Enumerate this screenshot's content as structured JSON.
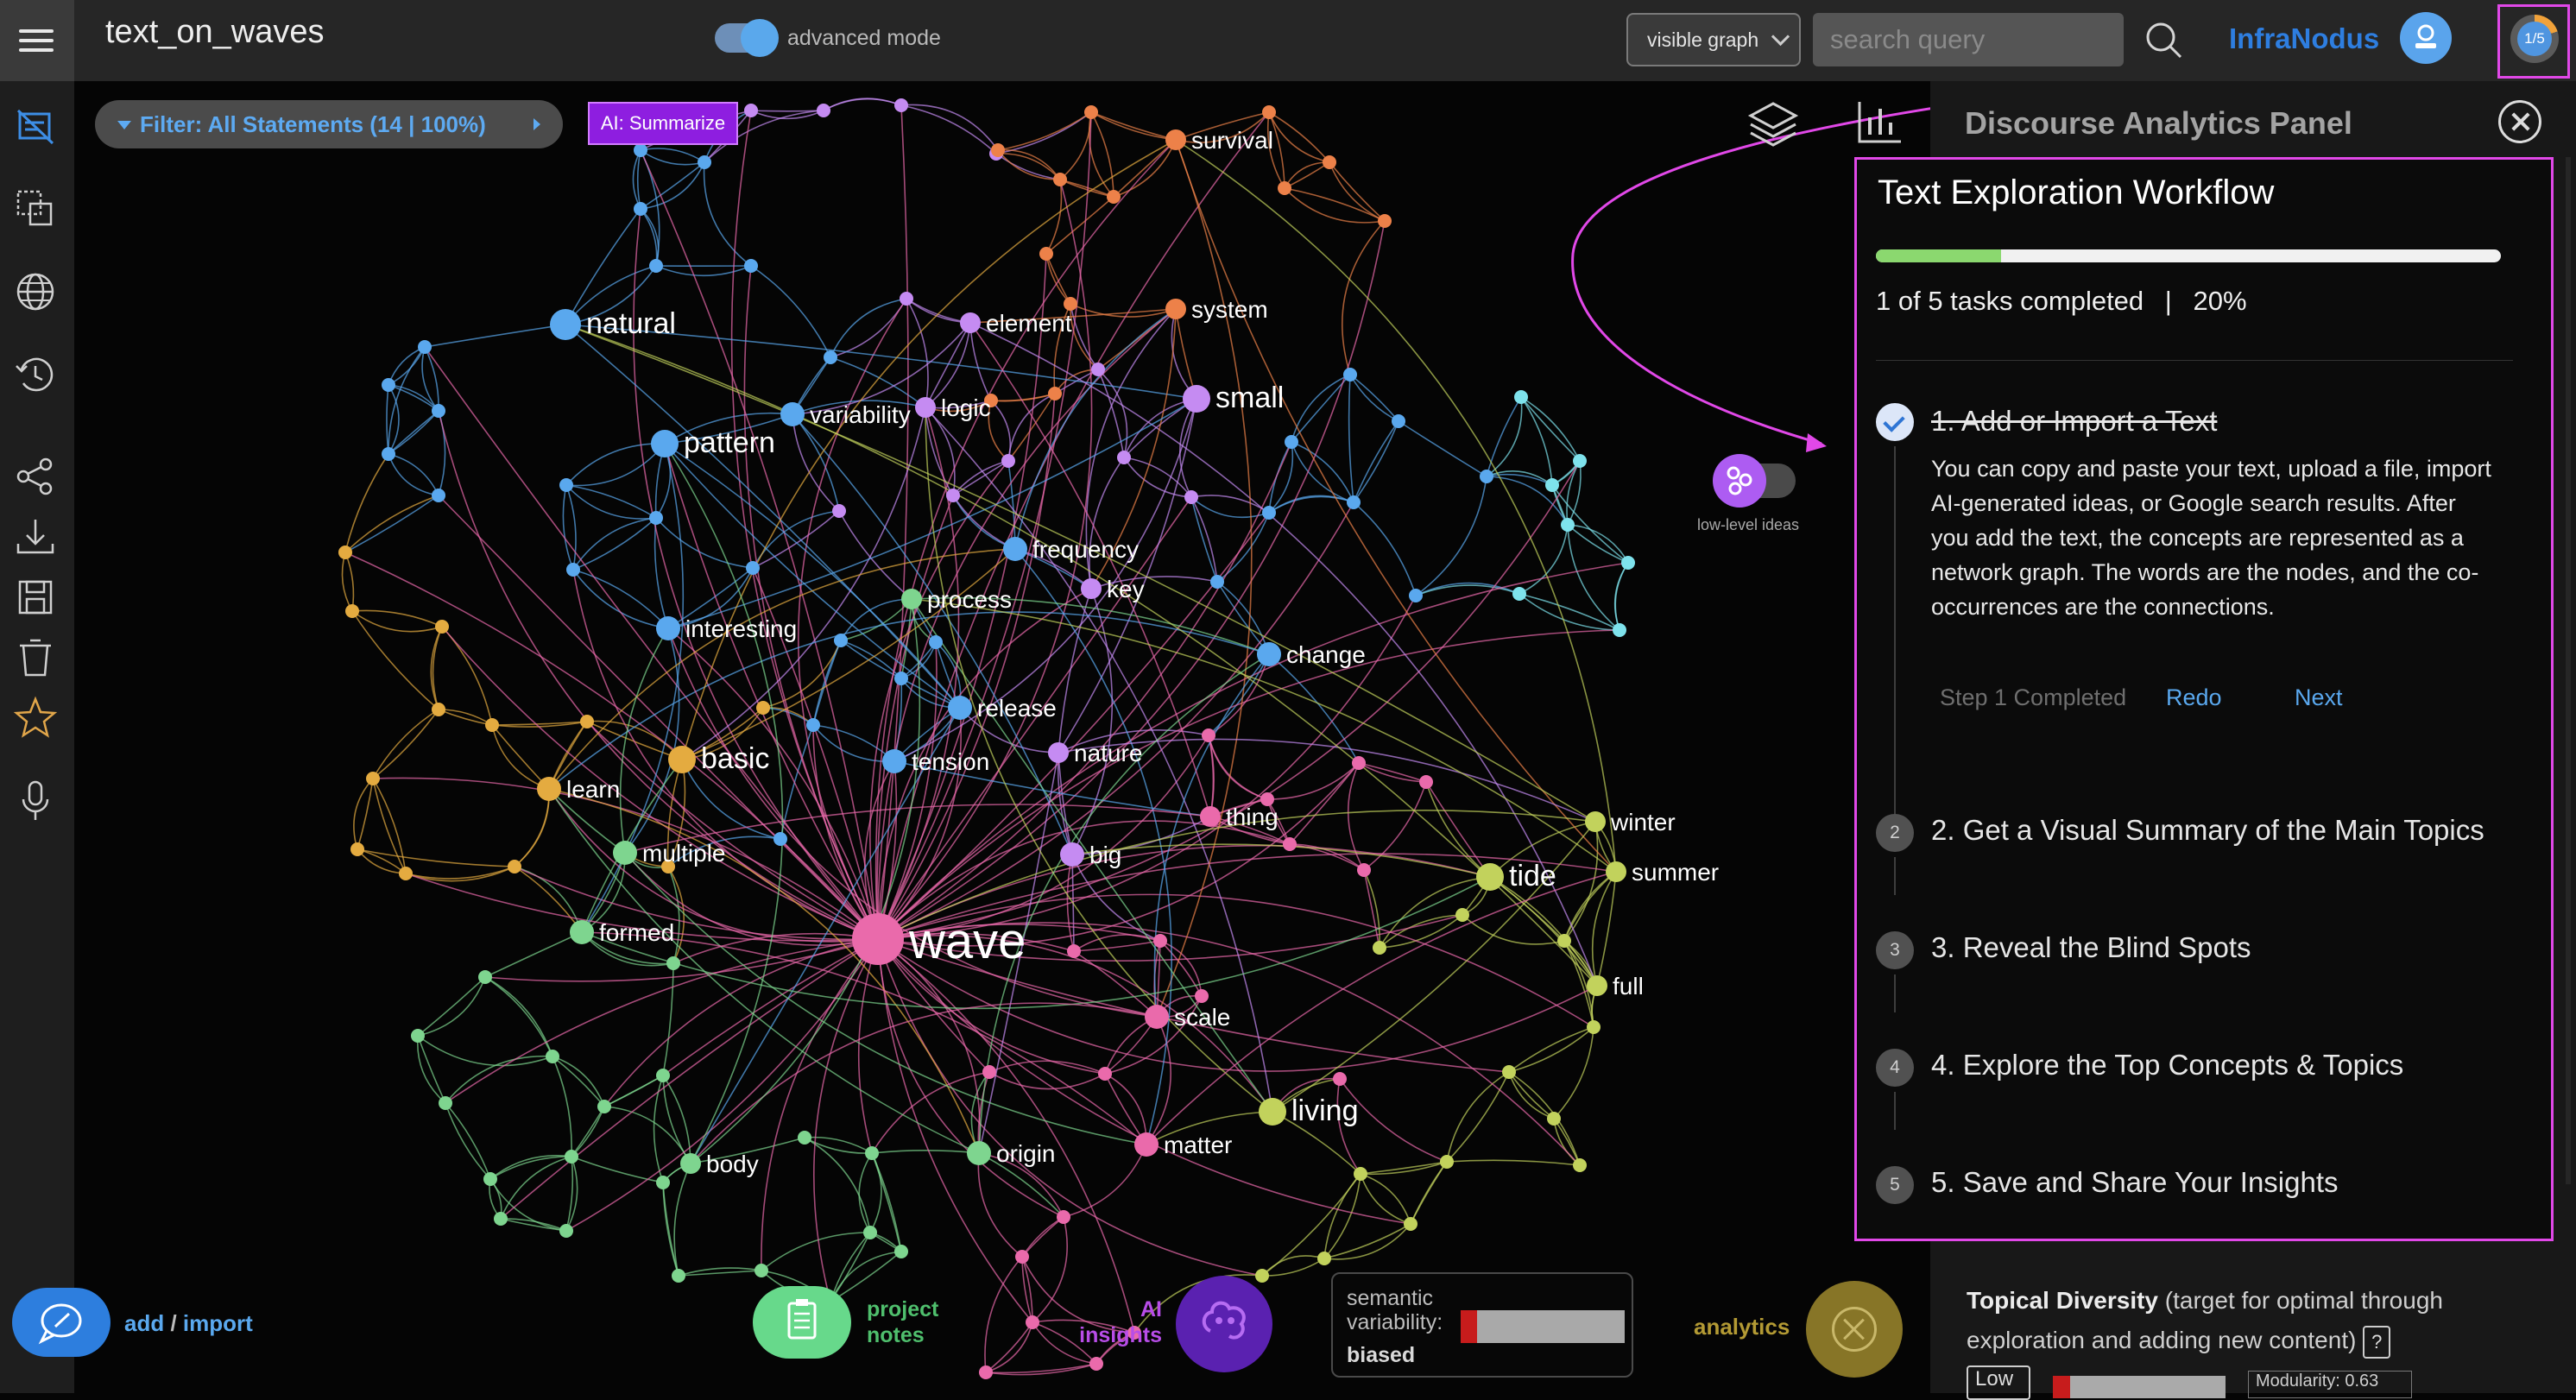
{
  "header": {
    "doc_title": "text_on_waves",
    "advanced_mode_label": "advanced mode",
    "advanced_mode_on": true,
    "graph_select_value": "visible graph",
    "search_placeholder": "search query",
    "brand": "InfraNodus",
    "progress_badge": "1/5",
    "progress_fraction": 0.2
  },
  "sidebar": {
    "icons": [
      "graph-filter-icon",
      "select-icon",
      "globe-icon",
      "history-icon",
      "share-icon",
      "download-icon",
      "save-icon",
      "trash-icon",
      "star-icon",
      "microphone-icon"
    ]
  },
  "graph": {
    "filter_label": "Filter: All Statements (14 | 100%)",
    "ai_summarize_label": "AI: Summarize",
    "low_level_label": "low-level ideas",
    "colors": {
      "blue": "#5aa8ee",
      "purple": "#c58bf2",
      "orange": "#ed8149",
      "yellow": "#e4ab40",
      "green": "#7ed58f",
      "pink": "#ea6aab",
      "lime": "#c2d25c",
      "cyan": "#7ee2ec"
    },
    "labels": {
      "wave": "wave",
      "natural": "natural",
      "pattern": "pattern",
      "variability": "variability",
      "logic": "logic",
      "element": "element",
      "system": "system",
      "small": "small",
      "survival": "survival",
      "frequency": "frequency",
      "key": "key",
      "process": "process",
      "interesting": "interesting",
      "change": "change",
      "release": "release",
      "basic": "basic",
      "tension": "tension",
      "nature": "nature",
      "learn": "learn",
      "thing": "thing",
      "multiple": "multiple",
      "big": "big",
      "tide": "tide",
      "winter": "winter",
      "summer": "summer",
      "formed": "formed",
      "full": "full",
      "scale": "scale",
      "living": "living",
      "body": "body",
      "origin": "origin",
      "matter": "matter"
    }
  },
  "panel": {
    "title": "Discourse Analytics Panel",
    "workflow_title": "Text Exploration Workflow",
    "tasks_completed_text": "1 of 5 tasks completed",
    "percent_text": "20%",
    "progress_fraction": 0.2,
    "steps": [
      {
        "num": "1",
        "label": "1. Add or Import a Text",
        "done": true
      },
      {
        "num": "2",
        "label": "2. Get a Visual Summary of the Main Topics",
        "done": false
      },
      {
        "num": "3",
        "label": "3. Reveal the Blind Spots",
        "done": false
      },
      {
        "num": "4",
        "label": "4. Explore the Top Concepts & Topics",
        "done": false
      },
      {
        "num": "5",
        "label": "5. Save and Share Your Insights",
        "done": false
      }
    ],
    "step1_description": "You can copy and paste your text, upload a file, import AI-generated ideas, or Google search results. After you add the text, the concepts are represented as a network graph. The words are the nodes, and the co-occurrences are the connections.",
    "step1_status": "Step 1 Completed",
    "redo_label": "Redo",
    "next_label": "Next",
    "diversity_title": "Topical Diversity",
    "diversity_text": "(target for optimal through exploration and adding new content)",
    "help_label": "?",
    "low_label": "Low",
    "diversity_fraction": 0.1,
    "modularity_text": "Modularity: 0.63"
  },
  "bottom": {
    "add_label": "add",
    "import_label": "import",
    "notes_line1": "project",
    "notes_line2": "notes",
    "insights_line1": "AI",
    "insights_line2": "insights",
    "semvar_line1": "semantic",
    "semvar_line2": "variability:",
    "semvar_value": "biased",
    "semvar_fraction": 0.1,
    "analytics_label": "analytics"
  }
}
